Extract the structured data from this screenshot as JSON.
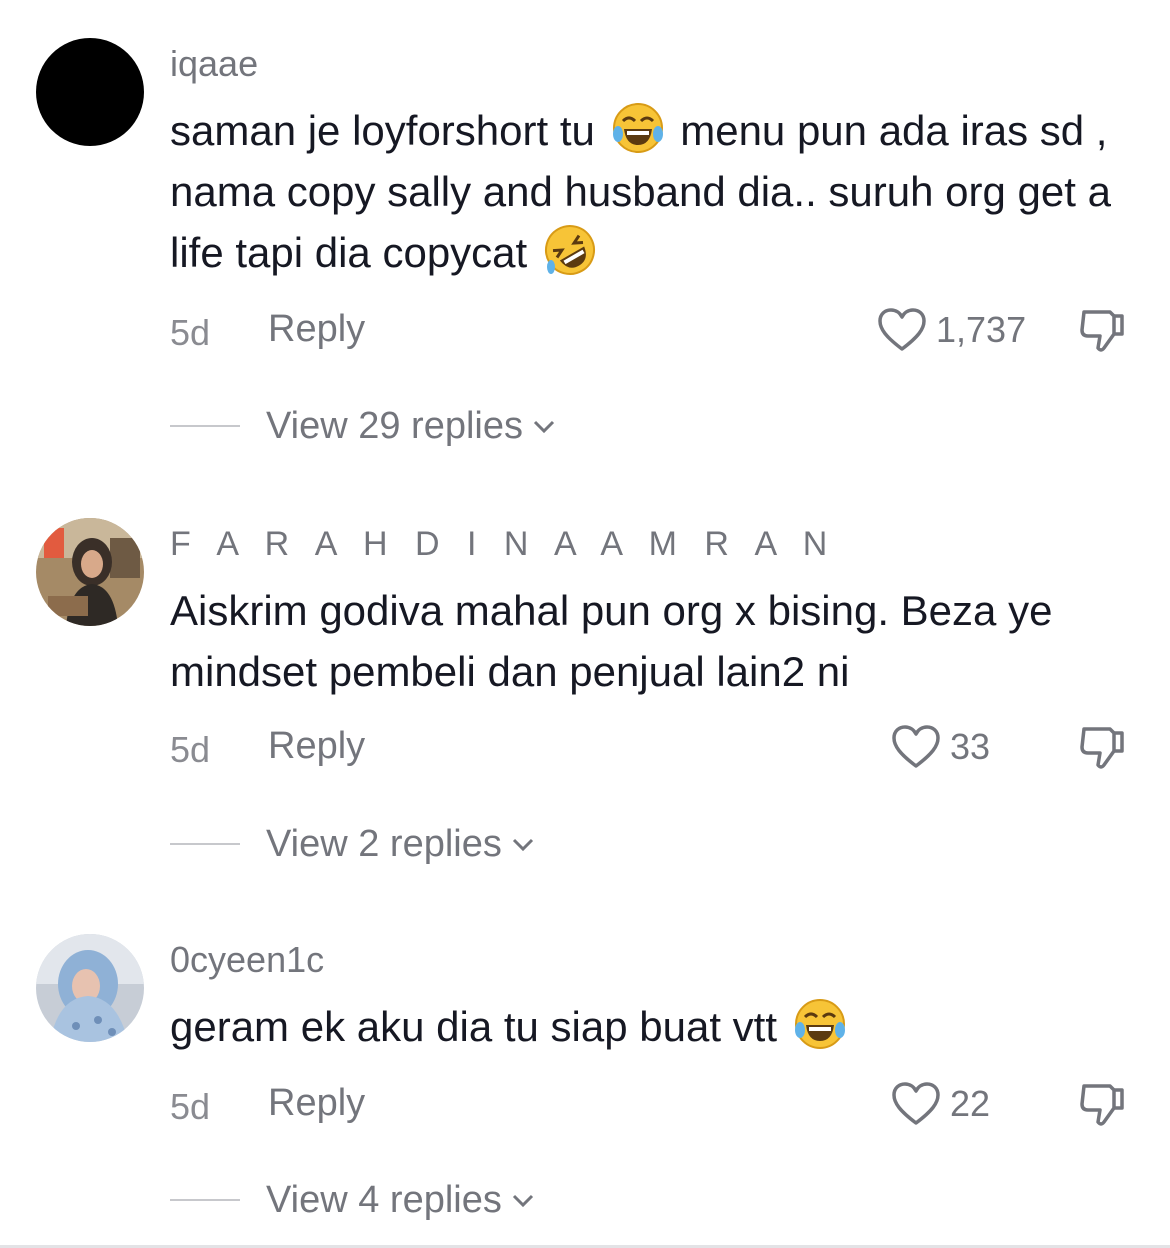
{
  "comments": [
    {
      "username": "iqaae",
      "text_parts": [
        "saman je loyforshort tu",
        "menu pun ada iras sd , nama copy sally and husband dia.. suruh org get a life tapi dia copycat"
      ],
      "emojis": [
        "face-with-tears-of-joy-emoji",
        "rolling-on-floor-laughing-emoji"
      ],
      "time": "5d",
      "reply_label": "Reply",
      "likes": "1,737",
      "view_replies": "View 29 replies"
    },
    {
      "username": "F A R A H D I N A A M R A N",
      "text": "Aiskrim godiva mahal pun org x bising. Beza ye mindset pembeli dan penjual lain2 ni",
      "time": "5d",
      "reply_label": "Reply",
      "likes": "33",
      "view_replies": "View 2 replies"
    },
    {
      "username": "0cyeen1c",
      "text": "geram ek aku dia tu siap buat vtt",
      "emojis": [
        "face-with-tears-of-joy-emoji"
      ],
      "time": "5d",
      "reply_label": "Reply",
      "likes": "22",
      "view_replies": "View 4 replies"
    }
  ],
  "icons": {
    "like": "heart-outline-icon",
    "dislike": "thumbs-down-outline-icon",
    "expand": "chevron-down-icon"
  },
  "colors": {
    "text_primary": "#161823",
    "text_secondary": "#73757c",
    "background": "#ffffff"
  }
}
